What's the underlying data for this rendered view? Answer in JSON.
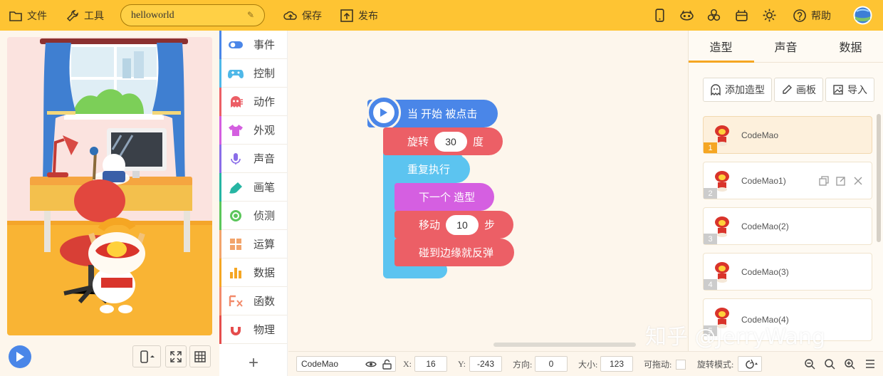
{
  "topbar": {
    "file": "文件",
    "tools": "工具",
    "project_name": "helloworld",
    "save": "保存",
    "publish": "发布",
    "help": "帮助",
    "icons": [
      "file-icon",
      "wrench-icon",
      "pencil-icon",
      "cloud-upload-icon",
      "publish-icon",
      "phone-icon",
      "eye-mask-icon",
      "cube-icon",
      "robot-icon",
      "gear-icon",
      "help-icon",
      "avatar"
    ]
  },
  "categories": [
    {
      "label": "事件",
      "color": "#4a86e8",
      "icon": "toggle-icon"
    },
    {
      "label": "控制",
      "color": "#4fb8e8",
      "icon": "gamepad-icon"
    },
    {
      "label": "动作",
      "color": "#ec5f66",
      "icon": "ghost-icon"
    },
    {
      "label": "外观",
      "color": "#d45fe0",
      "icon": "shirt-icon"
    },
    {
      "label": "声音",
      "color": "#8a6de8",
      "icon": "mic-icon"
    },
    {
      "label": "画笔",
      "color": "#26b5a3",
      "icon": "brush-icon"
    },
    {
      "label": "侦测",
      "color": "#5bc65b",
      "icon": "detect-icon"
    },
    {
      "label": "运算",
      "color": "#f2a46b",
      "icon": "calc-icon"
    },
    {
      "label": "数据",
      "color": "#f5a623",
      "icon": "bar-chart-icon"
    },
    {
      "label": "函数",
      "color": "#f28b6b",
      "icon": "function-icon"
    },
    {
      "label": "物理",
      "color": "#e54d4d",
      "icon": "magnet-icon"
    }
  ],
  "add_category": "+",
  "blocks": {
    "when_start": "当 开始 被点击",
    "rotate": {
      "label": "旋转",
      "value": "30",
      "unit": "度"
    },
    "repeat": "重复执行",
    "next_costume": "下一个 造型",
    "move": {
      "label": "移动",
      "value": "10",
      "unit": "步"
    },
    "bounce": "碰到边缘就反弹"
  },
  "right_panel": {
    "tabs": [
      "造型",
      "声音",
      "数据"
    ],
    "active_tab": "造型",
    "buttons": {
      "add": "添加造型",
      "paint": "画板",
      "import": "导入"
    },
    "sprites": [
      {
        "num": "1",
        "name": "CodeMao"
      },
      {
        "num": "2",
        "name": "CodeMao1)"
      },
      {
        "num": "3",
        "name": "CodeMao(2)"
      },
      {
        "num": "4",
        "name": "CodeMao(3)"
      },
      {
        "num": "5",
        "name": "CodeMao(4)"
      }
    ]
  },
  "bottom": {
    "sprite": "CodeMao",
    "x_label": "X:",
    "x": "16",
    "y_label": "Y:",
    "y": "-243",
    "dir_label": "方向:",
    "dir": "0",
    "size_label": "大小:",
    "size": "123",
    "drag_label": "可拖动:",
    "rot_label": "旋转模式:"
  },
  "watermark": "知乎 @JerryWang",
  "colors": {
    "topbar": "#fec433",
    "event": "#4a86e8",
    "motion": "#ec5f66",
    "control": "#4fc3f7",
    "looks": "#d55fe1",
    "accent": "#f5a623"
  }
}
